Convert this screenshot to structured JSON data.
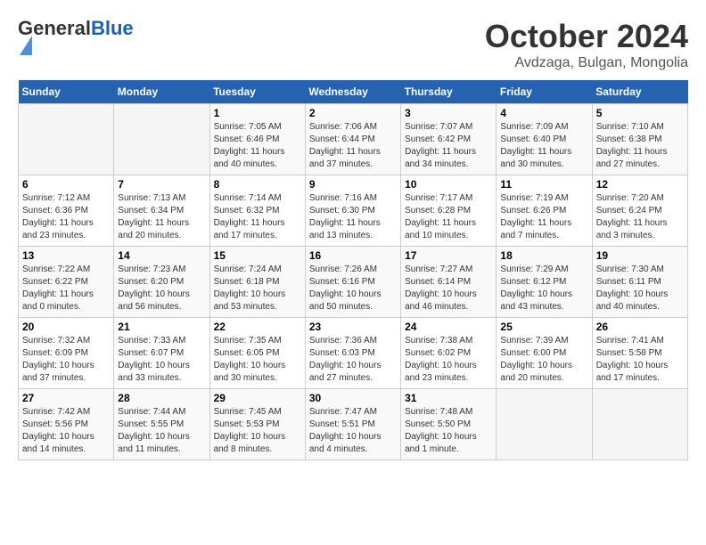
{
  "header": {
    "logo_general": "General",
    "logo_blue": "Blue",
    "month_title": "October 2024",
    "location": "Avdzaga, Bulgan, Mongolia"
  },
  "days_of_week": [
    "Sunday",
    "Monday",
    "Tuesday",
    "Wednesday",
    "Thursday",
    "Friday",
    "Saturday"
  ],
  "weeks": [
    [
      {
        "day": "",
        "empty": true
      },
      {
        "day": "",
        "empty": true
      },
      {
        "day": "1",
        "sunrise": "Sunrise: 7:05 AM",
        "sunset": "Sunset: 6:46 PM",
        "daylight": "Daylight: 11 hours and 40 minutes."
      },
      {
        "day": "2",
        "sunrise": "Sunrise: 7:06 AM",
        "sunset": "Sunset: 6:44 PM",
        "daylight": "Daylight: 11 hours and 37 minutes."
      },
      {
        "day": "3",
        "sunrise": "Sunrise: 7:07 AM",
        "sunset": "Sunset: 6:42 PM",
        "daylight": "Daylight: 11 hours and 34 minutes."
      },
      {
        "day": "4",
        "sunrise": "Sunrise: 7:09 AM",
        "sunset": "Sunset: 6:40 PM",
        "daylight": "Daylight: 11 hours and 30 minutes."
      },
      {
        "day": "5",
        "sunrise": "Sunrise: 7:10 AM",
        "sunset": "Sunset: 6:38 PM",
        "daylight": "Daylight: 11 hours and 27 minutes."
      }
    ],
    [
      {
        "day": "6",
        "sunrise": "Sunrise: 7:12 AM",
        "sunset": "Sunset: 6:36 PM",
        "daylight": "Daylight: 11 hours and 23 minutes."
      },
      {
        "day": "7",
        "sunrise": "Sunrise: 7:13 AM",
        "sunset": "Sunset: 6:34 PM",
        "daylight": "Daylight: 11 hours and 20 minutes."
      },
      {
        "day": "8",
        "sunrise": "Sunrise: 7:14 AM",
        "sunset": "Sunset: 6:32 PM",
        "daylight": "Daylight: 11 hours and 17 minutes."
      },
      {
        "day": "9",
        "sunrise": "Sunrise: 7:16 AM",
        "sunset": "Sunset: 6:30 PM",
        "daylight": "Daylight: 11 hours and 13 minutes."
      },
      {
        "day": "10",
        "sunrise": "Sunrise: 7:17 AM",
        "sunset": "Sunset: 6:28 PM",
        "daylight": "Daylight: 11 hours and 10 minutes."
      },
      {
        "day": "11",
        "sunrise": "Sunrise: 7:19 AM",
        "sunset": "Sunset: 6:26 PM",
        "daylight": "Daylight: 11 hours and 7 minutes."
      },
      {
        "day": "12",
        "sunrise": "Sunrise: 7:20 AM",
        "sunset": "Sunset: 6:24 PM",
        "daylight": "Daylight: 11 hours and 3 minutes."
      }
    ],
    [
      {
        "day": "13",
        "sunrise": "Sunrise: 7:22 AM",
        "sunset": "Sunset: 6:22 PM",
        "daylight": "Daylight: 11 hours and 0 minutes."
      },
      {
        "day": "14",
        "sunrise": "Sunrise: 7:23 AM",
        "sunset": "Sunset: 6:20 PM",
        "daylight": "Daylight: 10 hours and 56 minutes."
      },
      {
        "day": "15",
        "sunrise": "Sunrise: 7:24 AM",
        "sunset": "Sunset: 6:18 PM",
        "daylight": "Daylight: 10 hours and 53 minutes."
      },
      {
        "day": "16",
        "sunrise": "Sunrise: 7:26 AM",
        "sunset": "Sunset: 6:16 PM",
        "daylight": "Daylight: 10 hours and 50 minutes."
      },
      {
        "day": "17",
        "sunrise": "Sunrise: 7:27 AM",
        "sunset": "Sunset: 6:14 PM",
        "daylight": "Daylight: 10 hours and 46 minutes."
      },
      {
        "day": "18",
        "sunrise": "Sunrise: 7:29 AM",
        "sunset": "Sunset: 6:12 PM",
        "daylight": "Daylight: 10 hours and 43 minutes."
      },
      {
        "day": "19",
        "sunrise": "Sunrise: 7:30 AM",
        "sunset": "Sunset: 6:11 PM",
        "daylight": "Daylight: 10 hours and 40 minutes."
      }
    ],
    [
      {
        "day": "20",
        "sunrise": "Sunrise: 7:32 AM",
        "sunset": "Sunset: 6:09 PM",
        "daylight": "Daylight: 10 hours and 37 minutes."
      },
      {
        "day": "21",
        "sunrise": "Sunrise: 7:33 AM",
        "sunset": "Sunset: 6:07 PM",
        "daylight": "Daylight: 10 hours and 33 minutes."
      },
      {
        "day": "22",
        "sunrise": "Sunrise: 7:35 AM",
        "sunset": "Sunset: 6:05 PM",
        "daylight": "Daylight: 10 hours and 30 minutes."
      },
      {
        "day": "23",
        "sunrise": "Sunrise: 7:36 AM",
        "sunset": "Sunset: 6:03 PM",
        "daylight": "Daylight: 10 hours and 27 minutes."
      },
      {
        "day": "24",
        "sunrise": "Sunrise: 7:38 AM",
        "sunset": "Sunset: 6:02 PM",
        "daylight": "Daylight: 10 hours and 23 minutes."
      },
      {
        "day": "25",
        "sunrise": "Sunrise: 7:39 AM",
        "sunset": "Sunset: 6:00 PM",
        "daylight": "Daylight: 10 hours and 20 minutes."
      },
      {
        "day": "26",
        "sunrise": "Sunrise: 7:41 AM",
        "sunset": "Sunset: 5:58 PM",
        "daylight": "Daylight: 10 hours and 17 minutes."
      }
    ],
    [
      {
        "day": "27",
        "sunrise": "Sunrise: 7:42 AM",
        "sunset": "Sunset: 5:56 PM",
        "daylight": "Daylight: 10 hours and 14 minutes."
      },
      {
        "day": "28",
        "sunrise": "Sunrise: 7:44 AM",
        "sunset": "Sunset: 5:55 PM",
        "daylight": "Daylight: 10 hours and 11 minutes."
      },
      {
        "day": "29",
        "sunrise": "Sunrise: 7:45 AM",
        "sunset": "Sunset: 5:53 PM",
        "daylight": "Daylight: 10 hours and 8 minutes."
      },
      {
        "day": "30",
        "sunrise": "Sunrise: 7:47 AM",
        "sunset": "Sunset: 5:51 PM",
        "daylight": "Daylight: 10 hours and 4 minutes."
      },
      {
        "day": "31",
        "sunrise": "Sunrise: 7:48 AM",
        "sunset": "Sunset: 5:50 PM",
        "daylight": "Daylight: 10 hours and 1 minute."
      },
      {
        "day": "",
        "empty": true
      },
      {
        "day": "",
        "empty": true
      }
    ]
  ]
}
